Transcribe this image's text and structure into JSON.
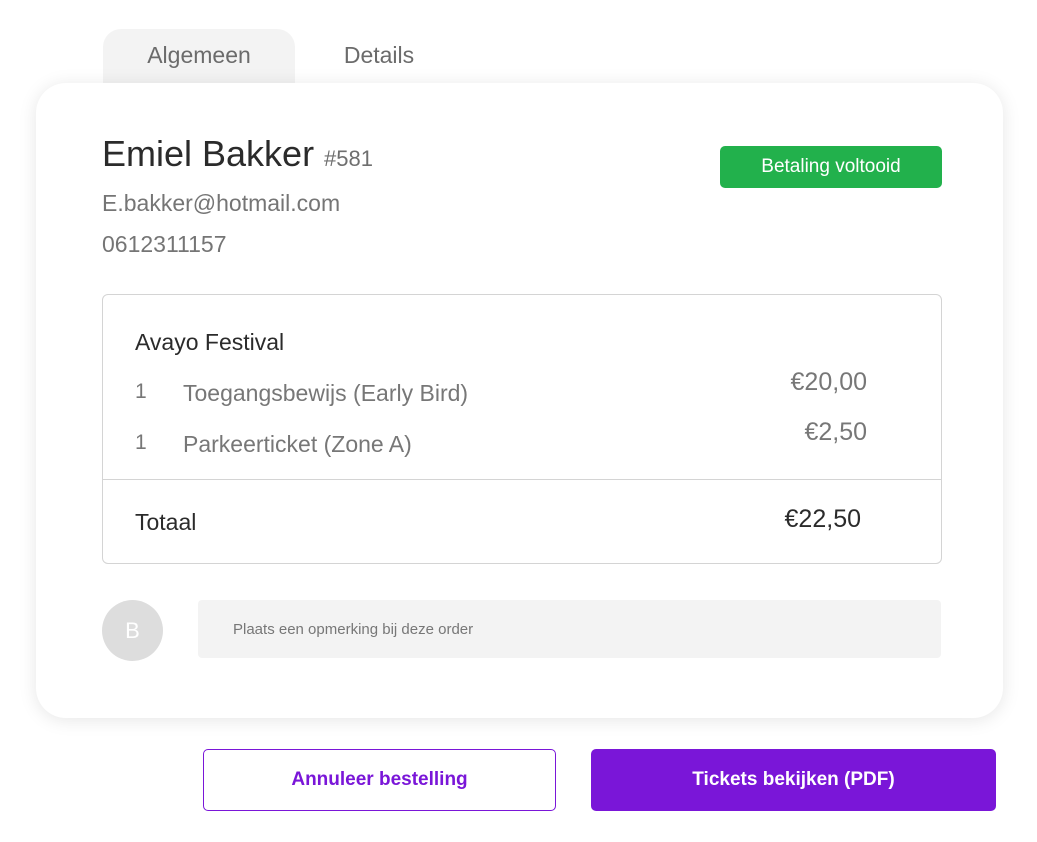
{
  "tabs": [
    {
      "label": "Algemeen",
      "active": true
    },
    {
      "label": "Details",
      "active": false
    }
  ],
  "customer": {
    "name": "Emiel Bakker",
    "order_number": "#581",
    "email": "E.bakker@hotmail.com",
    "phone": "0612311157"
  },
  "status": {
    "label": "Betaling voltooid",
    "color": "#22b14c"
  },
  "order": {
    "event_name": "Avayo Festival",
    "items": [
      {
        "qty": "1",
        "description": "Toegangsbewijs (Early Bird)",
        "price": "€20,00"
      },
      {
        "qty": "1",
        "description": "Parkeerticket (Zone A)",
        "price": "€2,50"
      }
    ],
    "total_label": "Totaal",
    "total_value": "€22,50"
  },
  "comment": {
    "avatar_initial": "B",
    "placeholder": "Plaats een opmerking bij deze order",
    "value": ""
  },
  "actions": {
    "cancel_label": "Annuleer bestelling",
    "tickets_label": "Tickets bekijken (PDF)",
    "accent_color": "#7a16d8"
  }
}
